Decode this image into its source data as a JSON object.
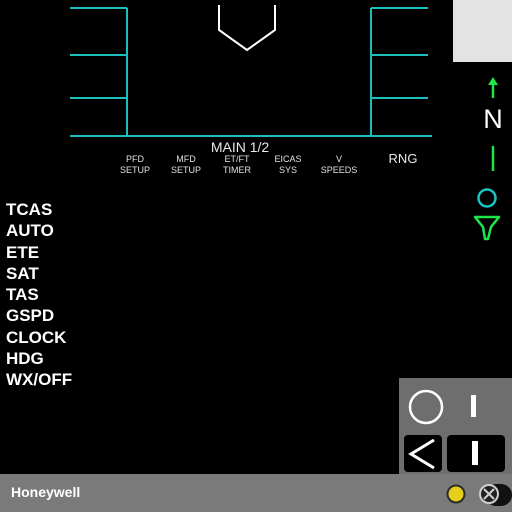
{
  "display": {
    "menu_title": "MAIN 1/2",
    "softkeys": [
      {
        "line1": "PFD",
        "line2": "SETUP"
      },
      {
        "line1": "MFD",
        "line2": "SETUP"
      },
      {
        "line1": "ET/FT",
        "line2": "TIMER"
      },
      {
        "line1": "EICAS",
        "line2": "SYS"
      },
      {
        "line1": "V",
        "line2": "SPEEDS"
      }
    ],
    "range_label": "RNG",
    "left_items": [
      "TCAS",
      "AUTO",
      "ETE",
      "SAT",
      "TAS",
      "GSPD",
      "CLOCK",
      "HDG",
      "WX/OFF"
    ],
    "north_label": "N"
  },
  "footer": {
    "brand": "Honeywell"
  },
  "colors": {
    "cyan": "#19c4c0",
    "green": "#1ee64a"
  }
}
